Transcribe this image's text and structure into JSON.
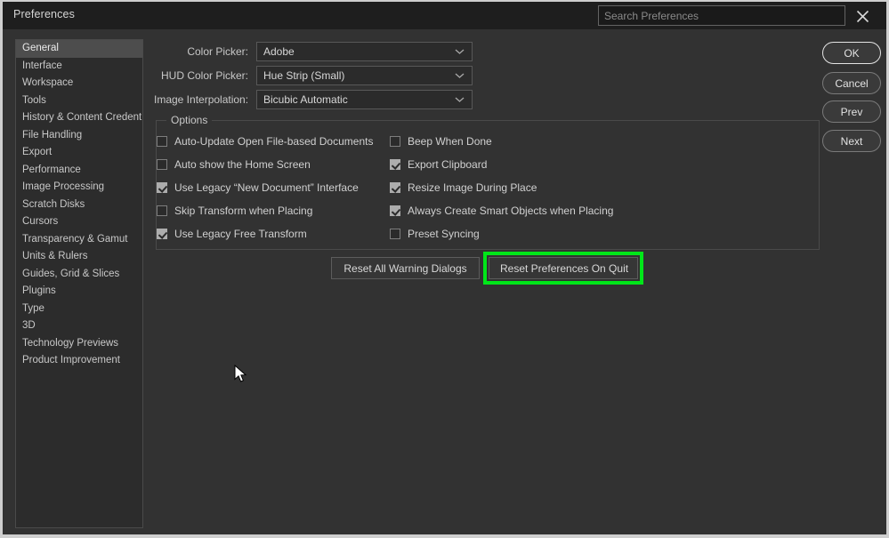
{
  "window": {
    "title": "Preferences",
    "accent_green": "#00e619",
    "background": "#323232"
  },
  "titlebar": {
    "search": {
      "placeholder": "Search Preferences",
      "value": ""
    },
    "close_icon": "close-icon"
  },
  "sidebar": {
    "selected": "General",
    "items": [
      {
        "label": "General"
      },
      {
        "label": "Interface"
      },
      {
        "label": "Workspace"
      },
      {
        "label": "Tools"
      },
      {
        "label": "History & Content Credentials"
      },
      {
        "label": "File Handling"
      },
      {
        "label": "Export"
      },
      {
        "label": "Performance"
      },
      {
        "label": "Image Processing"
      },
      {
        "label": "Scratch Disks"
      },
      {
        "label": "Cursors"
      },
      {
        "label": "Transparency & Gamut"
      },
      {
        "label": "Units & Rulers"
      },
      {
        "label": "Guides, Grid & Slices"
      },
      {
        "label": "Plugins"
      },
      {
        "label": "Type"
      },
      {
        "label": "3D"
      },
      {
        "label": "Technology Previews"
      },
      {
        "label": "Product Improvement"
      }
    ]
  },
  "main": {
    "selects": [
      {
        "label": "Color Picker:",
        "value": "Adobe"
      },
      {
        "label": "HUD Color Picker:",
        "value": "Hue Strip (Small)"
      },
      {
        "label": "Image Interpolation:",
        "value": "Bicubic Automatic"
      }
    ],
    "options": {
      "legend": "Options",
      "left_column": [
        {
          "label": "Auto-Update Open File-based Documents",
          "checked": false
        },
        {
          "label": "Auto show the Home Screen",
          "checked": false
        },
        {
          "label": "Use Legacy “New Document” Interface",
          "checked": true
        },
        {
          "label": "Skip Transform when Placing",
          "checked": false
        },
        {
          "label": "Use Legacy Free Transform",
          "checked": true
        }
      ],
      "right_column": [
        {
          "label": "Beep When Done",
          "checked": false
        },
        {
          "label": "Export Clipboard",
          "checked": true
        },
        {
          "label": "Resize Image During Place",
          "checked": true
        },
        {
          "label": "Always Create Smart Objects when Placing",
          "checked": true
        },
        {
          "label": "Preset Syncing",
          "checked": false
        }
      ]
    },
    "actions": [
      {
        "label": "Reset All Warning Dialogs",
        "highlighted": false
      },
      {
        "label": "Reset Preferences On Quit",
        "highlighted": true
      }
    ]
  },
  "side_buttons": [
    {
      "label": "OK",
      "primary": true
    },
    {
      "label": "Cancel",
      "primary": false
    },
    {
      "label": "Prev",
      "primary": false
    },
    {
      "label": "Next",
      "primary": false
    }
  ]
}
